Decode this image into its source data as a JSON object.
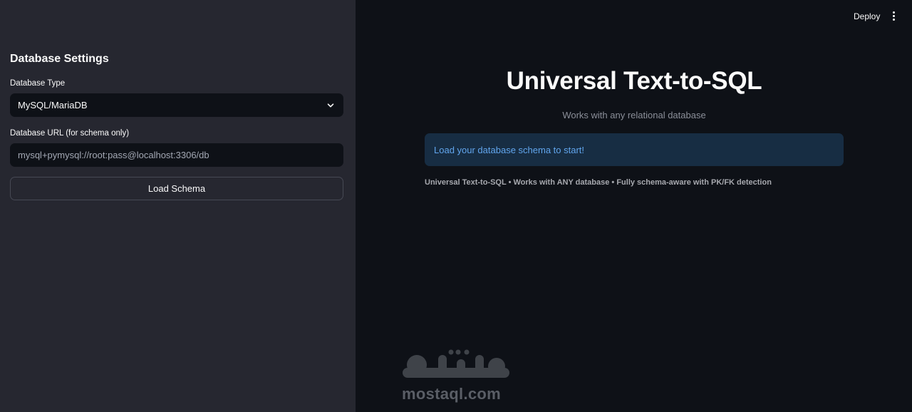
{
  "sidebar": {
    "title": "Database Settings",
    "db_type": {
      "label": "Database Type",
      "selected": "MySQL/MariaDB"
    },
    "db_url": {
      "label": "Database URL (for schema only)",
      "placeholder": "mysql+pymysql://root:pass@localhost:3306/db"
    },
    "load_button": "Load Schema"
  },
  "header": {
    "deploy_label": "Deploy",
    "menu_icon": "more-vertical-icon"
  },
  "main": {
    "title": "Universal Text-to-SQL",
    "subtitle": "Works with any relational database",
    "info_message": "Load your database schema to start!",
    "footer": "Universal Text-to-SQL • Works with ANY database • Fully schema-aware with PK/FK detection"
  },
  "watermark": {
    "logo_text": "مستقل",
    "domain": "mostaql.com"
  },
  "colors": {
    "app_background": "#0e1117",
    "sidebar_background": "#262730",
    "info_background": "#172d43",
    "info_text": "#61a5ed"
  }
}
